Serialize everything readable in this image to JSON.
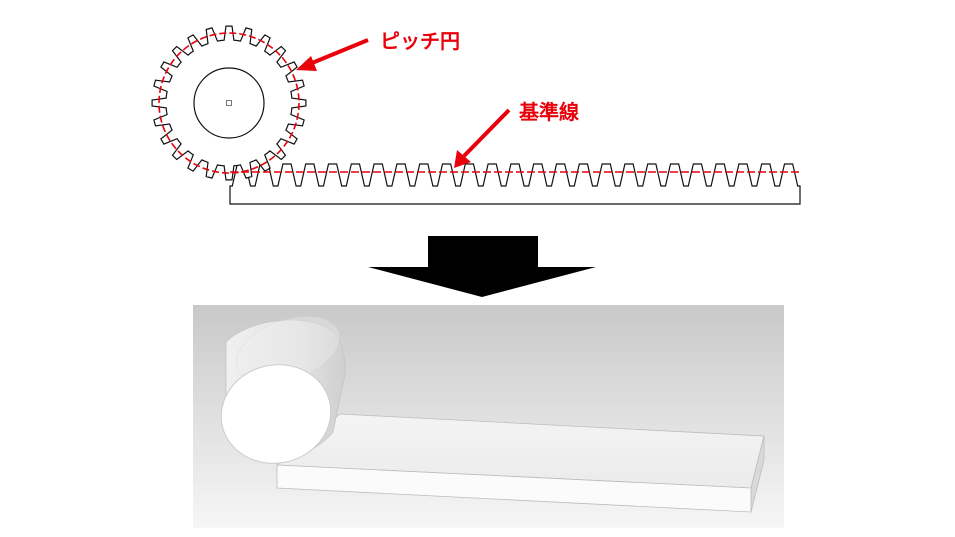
{
  "labels": {
    "pitch_circle": "ピッチ円",
    "reference_line": "基準線"
  },
  "colors": {
    "annotation": "#e8000b",
    "outline": "#111111",
    "arrow_fill": "#000000",
    "render_background_top": "#c9c9c9",
    "render_background_bottom": "#f4f4f4"
  },
  "gear": {
    "tooth_count": 24
  },
  "rack": {
    "tooth_count": 25
  }
}
